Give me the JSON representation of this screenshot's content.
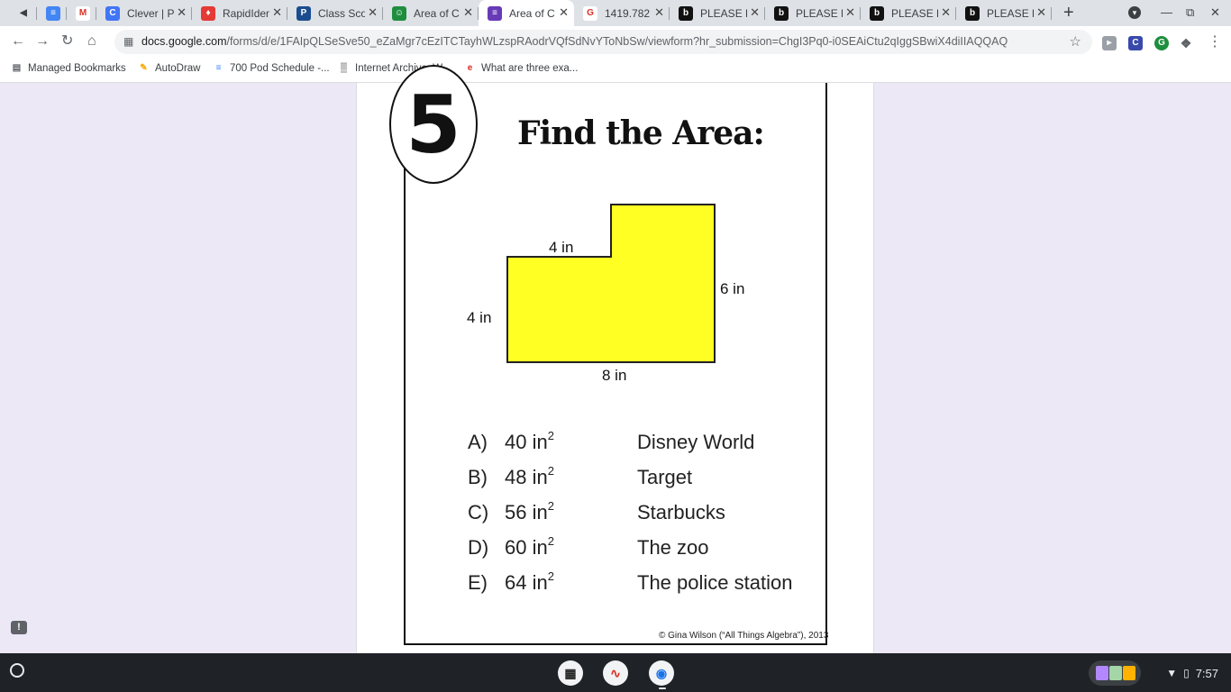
{
  "browser": {
    "tabs": [
      {
        "label": "",
        "icon": "audio-icon",
        "icon_color": "#3c4043",
        "glyph": "◀"
      },
      {
        "label": "",
        "icon": "google-docs-icon",
        "icon_color": "#4285f4",
        "glyph": "≡"
      },
      {
        "label": "",
        "icon": "gmail-icon",
        "icon_color": "#ffffff",
        "glyph": "M"
      },
      {
        "label": "Clever | P",
        "icon": "clever-icon",
        "icon_color": "#4274f6",
        "glyph": "C"
      },
      {
        "label": "RapidIden",
        "icon": "rapididentity-icon",
        "icon_color": "#e53935",
        "glyph": "♦"
      },
      {
        "label": "Class Sco",
        "icon": "classscope-icon",
        "icon_color": "#1a4d8f",
        "glyph": "P"
      },
      {
        "label": "Area of C",
        "icon": "google-classroom-icon",
        "icon_color": "#1e8e3e",
        "glyph": "☺"
      },
      {
        "label": "Area of C",
        "icon": "google-forms-icon",
        "icon_color": "#673ab7",
        "glyph": "≡",
        "active": true
      },
      {
        "label": "1419.782",
        "icon": "google-search-icon",
        "icon_color": "#ffffff",
        "glyph": "G"
      },
      {
        "label": "PLEASE H",
        "icon": "brainly-icon",
        "icon_color": "#111111",
        "glyph": "b"
      },
      {
        "label": "PLEASE H",
        "icon": "brainly-icon",
        "icon_color": "#111111",
        "glyph": "b"
      },
      {
        "label": "PLEASE H",
        "icon": "brainly-icon",
        "icon_color": "#111111",
        "glyph": "b"
      },
      {
        "label": "PLEASE H",
        "icon": "brainly-icon",
        "icon_color": "#111111",
        "glyph": "b"
      }
    ],
    "close_glyph": "✕",
    "new_tab_glyph": "+",
    "url_host": "docs.google.com",
    "url_path": "/forms/d/e/1FAIpQLSeSve50_eZaMgr7cEzITCTayhWLzspRAodrVQfSdNvYToNbSw/viewform?hr_submission=ChgI3Pq0-i0SEAiCtu2qIggSBwiX4diIIAQQAQ",
    "bookmarks": [
      {
        "label": "Managed Bookmarks",
        "icon": "folder-icon",
        "glyph": "▤",
        "color": "#5f6368"
      },
      {
        "label": "AutoDraw",
        "icon": "autodraw-icon",
        "glyph": "✎",
        "color": "#f9ab00"
      },
      {
        "label": "700 Pod Schedule -...",
        "icon": "google-docs-icon",
        "glyph": "≡",
        "color": "#4285f4"
      },
      {
        "label": "Internet Archive: W...",
        "icon": "internet-archive-icon",
        "glyph": "▒",
        "color": "#111111"
      },
      {
        "label": "What are three exa...",
        "icon": "site-icon",
        "glyph": "e",
        "color": "#d93025"
      }
    ]
  },
  "worksheet": {
    "number": "5",
    "title": "Find the Area:",
    "shape_fill": "#ffff24",
    "dimensions": {
      "top_left": "4 in",
      "left": "4 in",
      "right": "6 in",
      "bottom": "8 in"
    },
    "choices": [
      {
        "letter": "A)",
        "value": "40 in",
        "exp": "2",
        "place": "Disney World"
      },
      {
        "letter": "B)",
        "value": "48 in",
        "exp": "2",
        "place": "Target"
      },
      {
        "letter": "C)",
        "value": "56 in",
        "exp": "2",
        "place": "Starbucks"
      },
      {
        "letter": "D)",
        "value": "60 in",
        "exp": "2",
        "place": "The zoo"
      },
      {
        "letter": "E)",
        "value": "64 in",
        "exp": "2",
        "place": "The police station"
      }
    ],
    "copyright": "© Gina Wilson (“All Things Algebra”), 2013"
  },
  "shelf": {
    "time": "7:57",
    "apps": [
      {
        "name": "calculator-app-icon",
        "color": "#f1f3f4"
      },
      {
        "name": "sound-app-icon",
        "color": "#f1f3f4"
      },
      {
        "name": "chrome-app-icon",
        "color": "#f1f3f4"
      }
    ]
  }
}
